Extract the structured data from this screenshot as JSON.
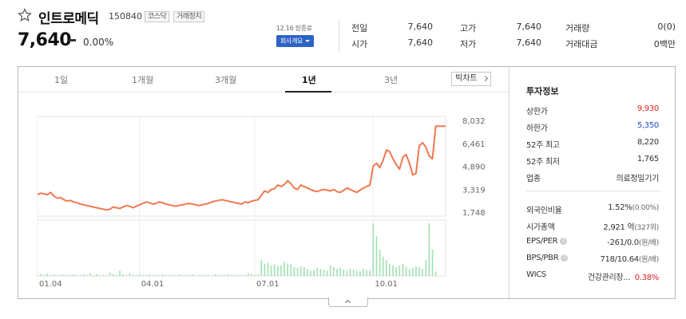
{
  "header": {
    "name": "인트로메딕",
    "code": "150840",
    "badges": [
      "코스닥",
      "거래정지"
    ],
    "price": "7,640",
    "change_rate": "0.00%",
    "base_date": "12.16 장종료",
    "company_button": "회사개요"
  },
  "quote": {
    "col1": [
      {
        "label": "전일",
        "value": "7,640"
      },
      {
        "label": "시가",
        "value": "7,640"
      }
    ],
    "col2": [
      {
        "label": "고가",
        "value": "7,640"
      },
      {
        "label": "저가",
        "value": "7,640"
      }
    ],
    "col3": [
      {
        "label": "거래량",
        "value": "0(0)"
      },
      {
        "label": "거래대금",
        "value": "0백만"
      }
    ]
  },
  "tabs": [
    "1일",
    "1개월",
    "3개월",
    "1년",
    "3년"
  ],
  "active_tab": "1년",
  "big_chart_button": "빅차트",
  "info": {
    "title": "투자정보",
    "rows_top": [
      {
        "label": "상한가",
        "value": "9,930",
        "color": "#e02020"
      },
      {
        "label": "하한가",
        "value": "5,350",
        "color": "#1e50c8"
      },
      {
        "label": "52주 최고",
        "value": "8,220"
      },
      {
        "label": "52주 최저",
        "value": "1,765"
      },
      {
        "label": "업종",
        "value": "의료정밀기기"
      }
    ],
    "foreign_label": "외국인비율",
    "foreign_value": "1.52%",
    "foreign_sub": "(0.00%)",
    "marketcap_label": "시가총액",
    "marketcap_value": "2,921 억",
    "marketcap_sub": "(327위)",
    "eps_label": "EPS/PER",
    "eps_value": "-261/0.0",
    "eps_sub": "(원/배)",
    "bps_label": "BPS/PBR",
    "bps_value": "718/10.64",
    "bps_sub": "(원/배)",
    "wics_label": "WICS",
    "wics_value": "건강관리장...",
    "wics_rate": "0.38%"
  },
  "chart_data": {
    "type": "line",
    "x_tick_labels": [
      "01.04",
      "04.01",
      "07.01",
      "10.01"
    ],
    "y_tick_labels": [
      "8,032",
      "6,461",
      "4,890",
      "3,319",
      "1,748"
    ],
    "ylim": [
      1748,
      8032
    ],
    "line_color": "#f07850",
    "volume_color": "#9fe0b0",
    "price": [
      2950,
      3050,
      3000,
      2950,
      3100,
      2850,
      2700,
      2750,
      2600,
      2500,
      2550,
      2450,
      2400,
      2300,
      2250,
      2200,
      2150,
      2100,
      2050,
      2000,
      1950,
      1900,
      1950,
      2100,
      2050,
      2000,
      2100,
      2200,
      2150,
      2050,
      2150,
      2250,
      2350,
      2450,
      2400,
      2300,
      2350,
      2450,
      2400,
      2300,
      2250,
      2200,
      2150,
      2200,
      2250,
      2300,
      2350,
      2300,
      2250,
      2200,
      2250,
      2300,
      2350,
      2450,
      2500,
      2550,
      2600,
      2550,
      2500,
      2450,
      2400,
      2350,
      2300,
      2450,
      2400,
      2500,
      2550,
      2600,
      2900,
      3200,
      3100,
      3300,
      3350,
      3600,
      3500,
      3650,
      3900,
      3700,
      3400,
      3300,
      3600,
      3500,
      3400,
      3300,
      3200,
      3150,
      3250,
      3300,
      3250,
      3200,
      3300,
      3150,
      3100,
      3250,
      3400,
      3300,
      3200,
      3100,
      3250,
      3400,
      3500,
      3600,
      4900,
      5100,
      4800,
      5300,
      6000,
      5900,
      5400,
      5000,
      4700,
      5500,
      5700,
      5100,
      4300,
      4400,
      6300,
      6500,
      6200,
      5600,
      5400,
      7640,
      7640,
      7640,
      7640
    ],
    "volume": [
      1,
      2,
      1,
      3,
      1,
      2,
      1,
      1,
      2,
      1,
      1,
      2,
      1,
      1,
      2,
      1,
      3,
      1,
      2,
      1,
      1,
      1,
      4,
      2,
      1,
      6,
      2,
      1,
      3,
      1,
      1,
      2,
      1,
      1,
      2,
      1,
      1,
      1,
      2,
      1,
      1,
      1,
      1,
      2,
      1,
      1,
      1,
      2,
      1,
      1,
      1,
      1,
      1,
      1,
      2,
      1,
      1,
      1,
      2,
      1,
      1,
      1,
      1,
      1,
      3,
      2,
      1,
      2,
      18,
      14,
      15,
      12,
      13,
      11,
      12,
      16,
      14,
      13,
      10,
      9,
      11,
      10,
      8,
      6,
      7,
      9,
      8,
      7,
      6,
      12,
      10,
      8,
      9,
      7,
      6,
      8,
      7,
      6,
      5,
      8,
      7,
      6,
      60,
      45,
      30,
      22,
      18,
      14,
      12,
      10,
      12,
      14,
      10,
      8,
      9,
      11,
      10,
      8,
      18,
      60,
      30,
      5,
      0,
      0,
      0
    ]
  }
}
